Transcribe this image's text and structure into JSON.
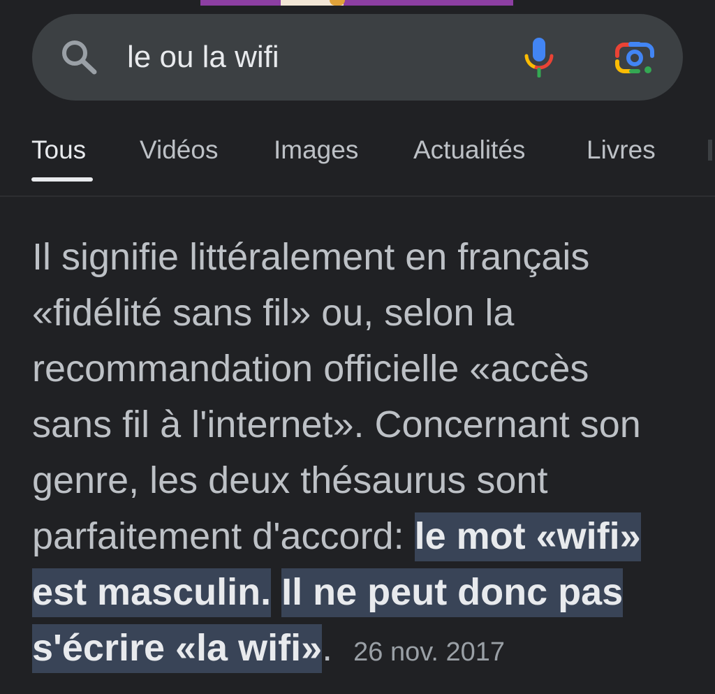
{
  "search": {
    "query": "le ou la wifi",
    "search_icon": "search-icon",
    "mic_icon": "microphone-icon",
    "lens_icon": "google-lens-icon"
  },
  "tabs": [
    {
      "label": "Tous",
      "active": true
    },
    {
      "label": "Vidéos",
      "active": false
    },
    {
      "label": "Images",
      "active": false
    },
    {
      "label": "Actualités",
      "active": false
    },
    {
      "label": "Livres",
      "active": false
    }
  ],
  "snippet": {
    "line1": "Il signifie littéralement en français",
    "line2": "«fidélité sans fil» ou, selon la",
    "line3": "recommandation officielle «accès",
    "line4": "sans fil à l'internet». Concernant son",
    "line5": "genre, les deux thésaurus sont",
    "line6_plain": "parfaitement d'accord: ",
    "line6_hl": "le mot «wifi»",
    "line7_hl_a": "est masculin.",
    "line7_hl_b": "Il ne peut donc pas",
    "line8_hl": "s'écrire «la wifi»",
    "line8_dot": ".",
    "date": "26 nov. 2017"
  },
  "colors": {
    "background": "#202124",
    "search_bar": "#3c4043",
    "highlight": "#394457",
    "text": "#bdc1c6",
    "text_strong": "#e8eaed"
  }
}
